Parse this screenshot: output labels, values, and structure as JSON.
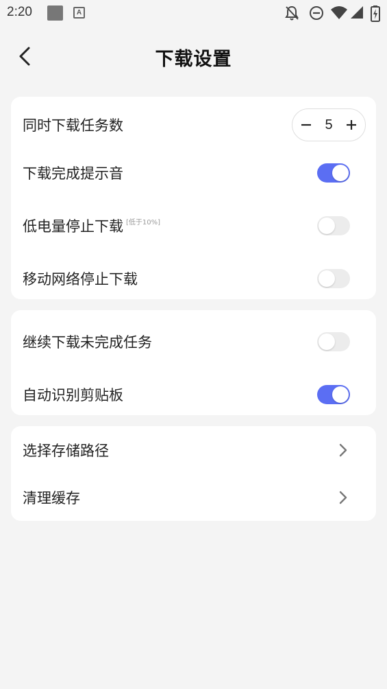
{
  "status_bar": {
    "time": "2:20",
    "icons": [
      "app-square-icon",
      "a-letter-icon",
      "bell-off-icon",
      "do-not-disturb-icon",
      "wifi-icon",
      "signal-icon",
      "battery-charging-icon"
    ]
  },
  "header": {
    "title": "下载设置",
    "back_icon": "back-arrow-icon"
  },
  "accent_color": "#5b6ef3",
  "group1": {
    "concurrent": {
      "label": "同时下载任务数",
      "value": "5"
    },
    "sound": {
      "label": "下载完成提示音",
      "on": true
    },
    "low_battery": {
      "label": "低电量停止下载",
      "note": "[低于10%]",
      "on": false
    },
    "mobile_network": {
      "label": "移动网络停止下载",
      "on": false
    }
  },
  "group2": {
    "resume": {
      "label": "继续下载未完成任务",
      "on": false
    },
    "clipboard": {
      "label": "自动识别剪贴板",
      "on": true
    }
  },
  "group3": {
    "storage_path": {
      "label": "选择存储路径"
    },
    "clear_cache": {
      "label": "清理缓存"
    }
  }
}
